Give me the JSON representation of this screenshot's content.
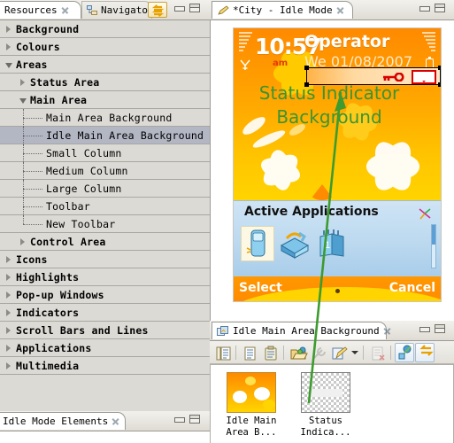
{
  "left_view": {
    "tabs": [
      {
        "label": "Resources",
        "active": true,
        "icon": "none"
      },
      {
        "label": "Navigator",
        "active": false,
        "icon": "navigator-icon"
      }
    ],
    "toggle_button": "link-with-editor-icon",
    "window_buttons": [
      "minimize",
      "maximize"
    ],
    "tree": [
      {
        "label": "Background",
        "level": 1,
        "twisty": "collapsed",
        "selected": false
      },
      {
        "label": "Colours",
        "level": 1,
        "twisty": "collapsed",
        "selected": false
      },
      {
        "label": "Areas",
        "level": 1,
        "twisty": "expanded",
        "selected": false
      },
      {
        "label": "Status Area",
        "level": 2,
        "twisty": "collapsed",
        "selected": false
      },
      {
        "label": "Main Area",
        "level": 2,
        "twisty": "expanded",
        "selected": false
      },
      {
        "label": "Main Area Background",
        "level": 3,
        "twisty": "none",
        "selected": false
      },
      {
        "label": "Idle Main Area Background",
        "level": 3,
        "twisty": "none",
        "selected": true
      },
      {
        "label": "Small Column",
        "level": 3,
        "twisty": "none",
        "selected": false
      },
      {
        "label": "Medium Column",
        "level": 3,
        "twisty": "none",
        "selected": false
      },
      {
        "label": "Large Column",
        "level": 3,
        "twisty": "none",
        "selected": false
      },
      {
        "label": "Toolbar",
        "level": 3,
        "twisty": "none",
        "selected": false
      },
      {
        "label": "New Toolbar",
        "level": 3,
        "twisty": "none",
        "selected": false,
        "last": true
      },
      {
        "label": "Control Area",
        "level": 2,
        "twisty": "collapsed",
        "selected": false
      },
      {
        "label": "Icons",
        "level": 1,
        "twisty": "collapsed",
        "selected": false
      },
      {
        "label": "Highlights",
        "level": 1,
        "twisty": "collapsed",
        "selected": false
      },
      {
        "label": "Pop-up Windows",
        "level": 1,
        "twisty": "collapsed",
        "selected": false
      },
      {
        "label": "Indicators",
        "level": 1,
        "twisty": "collapsed",
        "selected": false
      },
      {
        "label": "Scroll Bars and Lines",
        "level": 1,
        "twisty": "collapsed",
        "selected": false
      },
      {
        "label": "Applications",
        "level": 1,
        "twisty": "collapsed",
        "selected": false
      },
      {
        "label": "Multimedia",
        "level": 1,
        "twisty": "collapsed",
        "selected": false
      }
    ]
  },
  "bottom_left_view": {
    "tab_label": "Idle Mode Elements",
    "window_buttons": [
      "minimize",
      "maximize"
    ]
  },
  "editor": {
    "tab_label": "*City - Idle Mode",
    "tab_icon": "pencil-icon",
    "window_buttons": [
      "minimize",
      "maximize"
    ],
    "phone": {
      "clock": "10:57",
      "ampm": "am",
      "operator": "Operator",
      "date": "We 01/08/2007",
      "indicator_icons": [
        "key-icon",
        "envelope-icon"
      ],
      "overlay_text": "Status\nIndicator\nBackground",
      "overlay_color": "#3b9434",
      "app_panel_title": "Active Applications",
      "app_panel_icons": [
        "phone-app-icon",
        "tools-app-icon",
        "calendar-app-icon"
      ],
      "app_panel_badge": "pinwheel-icon",
      "softkey_left": "Select",
      "softkey_right": "Cancel"
    }
  },
  "properties_view": {
    "tab_label": "Idle Main Area Background",
    "tab_icon": "images-icon",
    "window_buttons": [
      "minimize",
      "maximize"
    ],
    "toolbar_buttons": [
      "list-view-icon",
      "copy-icon",
      "paste-icon",
      "open-folder-icon",
      "wrench-icon",
      "edit-icon",
      "dropdown-arrow-icon",
      "delete-icon",
      "properties-icon",
      "back-icon"
    ],
    "gallery": [
      {
        "caption": "Idle Main\nArea B...",
        "kind": "image"
      },
      {
        "caption": "Status\nIndica...",
        "kind": "transparent"
      }
    ]
  },
  "colors": {
    "orange": "#ff9800",
    "yellow": "#ffd400",
    "green_annotation": "#3b9434",
    "selection_row": "#b3b6c3",
    "panel_bg": "#ece9e3"
  }
}
